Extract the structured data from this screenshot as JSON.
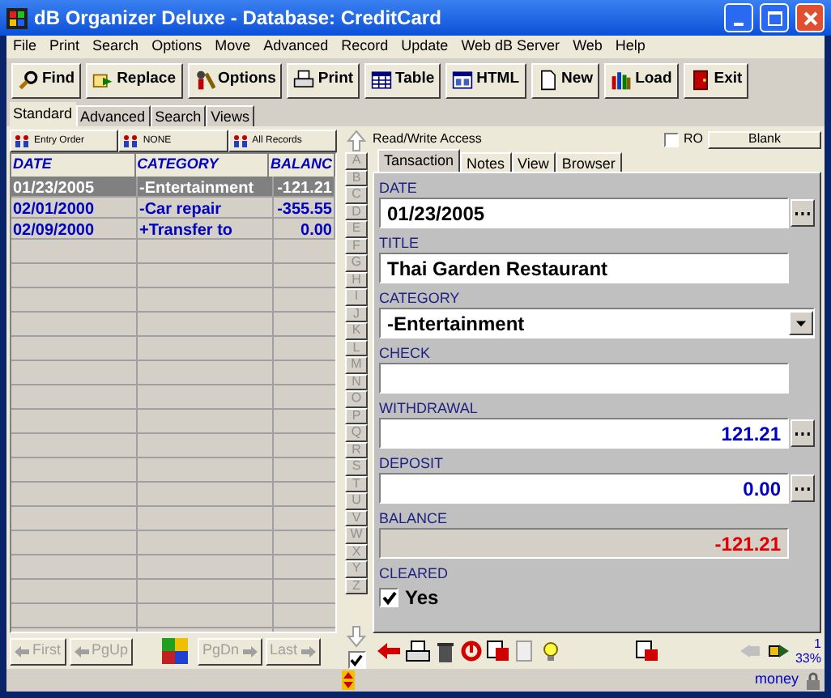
{
  "window": {
    "title": "dB Organizer Deluxe - Database: CreditCard"
  },
  "menu": [
    "File",
    "Print",
    "Search",
    "Options",
    "Move",
    "Advanced",
    "Record",
    "Update",
    "Web dB Server",
    "Web",
    "Help"
  ],
  "toolbar": [
    {
      "label": "Find",
      "kind": "find"
    },
    {
      "label": "Replace",
      "kind": "replace"
    },
    {
      "label": "Options",
      "kind": "options"
    },
    {
      "label": "Print",
      "kind": "print"
    },
    {
      "label": "Table",
      "kind": "table"
    },
    {
      "label": "HTML",
      "kind": "html"
    },
    {
      "label": "New",
      "kind": "new"
    },
    {
      "label": "Load",
      "kind": "load"
    },
    {
      "label": "Exit",
      "kind": "exit"
    }
  ],
  "tabs": [
    {
      "label": "Standard",
      "selected": true
    },
    {
      "label": "Advanced",
      "selected": false
    },
    {
      "label": "Search",
      "selected": false
    },
    {
      "label": "Views",
      "selected": false
    }
  ],
  "sort_buttons": [
    "Entry Order",
    "NONE",
    "All Records"
  ],
  "table": {
    "columns": [
      "DATE",
      "CATEGORY",
      "BALANC"
    ],
    "rows": [
      {
        "cells": [
          "01/23/2005",
          "-Entertainment",
          "-121.21"
        ],
        "selected": true
      },
      {
        "cells": [
          "02/01/2000",
          "-Car repair",
          "-355.55"
        ],
        "selected": false
      },
      {
        "cells": [
          "02/09/2000",
          "+Transfer to",
          "0.00"
        ],
        "selected": false
      }
    ]
  },
  "alphabet": [
    "A",
    "B",
    "C",
    "D",
    "E",
    "F",
    "G",
    "H",
    "I",
    "J",
    "K",
    "L",
    "M",
    "N",
    "O",
    "P",
    "Q",
    "R",
    "S",
    "T",
    "U",
    "V",
    "W",
    "X",
    "Y",
    "Z"
  ],
  "nav_buttons": [
    {
      "label": "First",
      "disabled": true
    },
    {
      "label": "PgUp",
      "disabled": true
    },
    {
      "label": "PgDn",
      "disabled": true
    },
    {
      "label": "Last",
      "disabled": true
    }
  ],
  "access": "Read/Write Access",
  "ro": {
    "label": "RO",
    "checked": false
  },
  "blank_button": "Blank",
  "record_tabs": [
    {
      "label": "Tansaction",
      "selected": true
    },
    {
      "label": "Notes",
      "selected": false
    },
    {
      "label": "View",
      "selected": false
    },
    {
      "label": "Browser",
      "selected": false
    }
  ],
  "fields": [
    {
      "label": "DATE",
      "value": "01/23/2005",
      "kind": "picker"
    },
    {
      "label": "TITLE",
      "value": "Thai Garden Restaurant",
      "kind": "text"
    },
    {
      "label": "CATEGORY",
      "value": "-Entertainment",
      "kind": "dropdown"
    },
    {
      "label": "CHECK",
      "kind": "text"
    },
    {
      "label": "WITHDRAWAL",
      "value": "121.21",
      "kind": "amount"
    },
    {
      "label": "DEPOSIT",
      "value": "0.00",
      "kind": "amount"
    },
    {
      "label": "BALANCE",
      "value": "-121.21",
      "kind": "readonly"
    },
    {
      "label": "CLEARED",
      "value": "Yes",
      "kind": "checkbox",
      "checked": true
    }
  ],
  "record_number": "1",
  "percent": "33%",
  "status": "money"
}
